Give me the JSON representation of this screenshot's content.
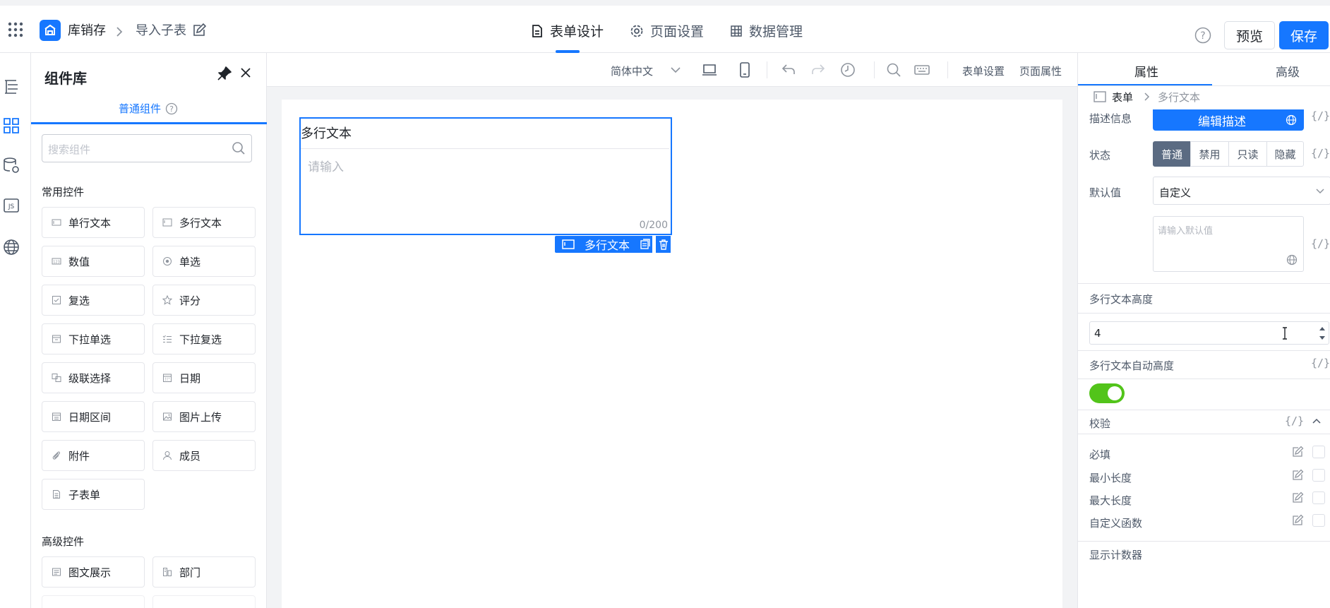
{
  "header": {
    "app_name": "库销存",
    "page_name": "导入子表",
    "tabs": [
      {
        "label": "表单设计",
        "icon": "document-icon"
      },
      {
        "label": "页面设置",
        "icon": "gear-icon"
      },
      {
        "label": "数据管理",
        "icon": "grid-icon"
      }
    ],
    "preview_label": "预览",
    "save_label": "保存"
  },
  "library": {
    "title": "组件库",
    "tab_label": "普通组件",
    "search_placeholder": "搜索组件",
    "common_title": "常用控件",
    "common_items": [
      "单行文本",
      "多行文本",
      "数值",
      "单选",
      "复选",
      "评分",
      "下拉单选",
      "下拉复选",
      "级联选择",
      "日期",
      "日期区间",
      "图片上传",
      "附件",
      "成员",
      "子表单"
    ],
    "advanced_title": "高级控件",
    "advanced_items": [
      "图文展示",
      "部门"
    ]
  },
  "toolbar": {
    "language": "简体中文",
    "form_settings": "表单设置",
    "page_props": "页面属性"
  },
  "canvas": {
    "field_label": "多行文本",
    "field_placeholder": "请输入",
    "field_counter": "0/200",
    "selected_tag": "多行文本"
  },
  "props": {
    "tab_props": "属性",
    "tab_advanced": "高级",
    "crumb_root": "表单",
    "crumb_current": "多行文本",
    "desc_label": "描述信息",
    "desc_button": "编辑描述",
    "status_label": "状态",
    "status_options": [
      "普通",
      "禁用",
      "只读",
      "隐藏"
    ],
    "status_selected": "普通",
    "default_label": "默认值",
    "default_mode": "自定义",
    "default_placeholder": "请输入默认值",
    "height_title": "多行文本高度",
    "height_value": "4",
    "auto_height_title": "多行文本自动高度",
    "auto_height_on": true,
    "validation_title": "校验",
    "validation_rules": [
      "必填",
      "最小长度",
      "最大长度",
      "自定义函数"
    ],
    "show_counter_title": "显示计数器",
    "code_symbol": "{/}"
  },
  "colors": {
    "primary": "#1677ff",
    "switch_on": "#52c41a",
    "segment_active": "#5b6b82"
  }
}
